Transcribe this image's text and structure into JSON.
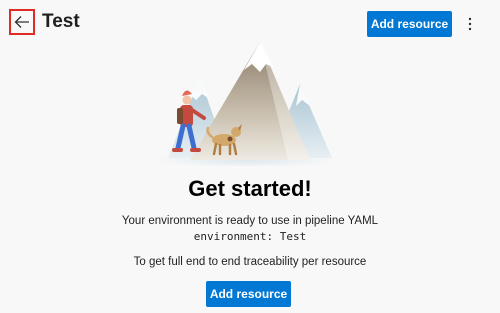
{
  "header": {
    "title": "Test",
    "add_resource_label": "Add resource",
    "more_icon": "more-vertical-icon",
    "back_icon": "arrow-left-icon"
  },
  "main": {
    "headline": "Get started!",
    "description": "Your environment is ready to use in pipeline YAML",
    "code": "environment: Test",
    "traceability_text": "To get full end to end traceability per resource",
    "add_resource_label": "Add resource"
  },
  "colors": {
    "accent": "#0078d4",
    "highlight_border": "#e02b24",
    "background": "#f8f8f8"
  }
}
